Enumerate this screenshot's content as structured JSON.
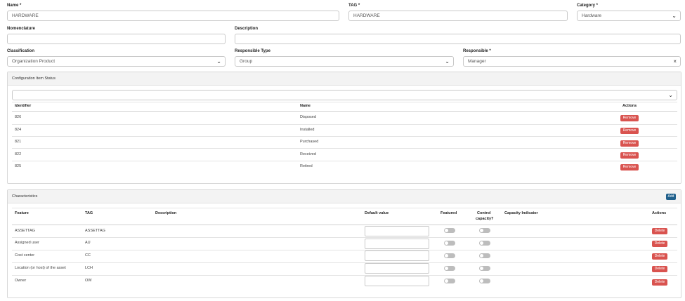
{
  "form": {
    "name": {
      "label": "Name *",
      "value": "HARDWARE"
    },
    "tag": {
      "label": "TAG *",
      "value": "HARDWARE"
    },
    "category": {
      "label": "Category *",
      "value": "Hardware"
    },
    "nomenclature": {
      "label": "Nomenclature",
      "value": ""
    },
    "description": {
      "label": "Description",
      "value": ""
    },
    "classification": {
      "label": "Classification",
      "value": "Organization Product"
    },
    "responsible_type": {
      "label": "Responsible Type",
      "value": "Group"
    },
    "responsible": {
      "label": "Responsible *",
      "value": "Manager"
    }
  },
  "status_panel": {
    "title": "Configuration Item Status",
    "columns": {
      "identifier": "Identifier",
      "name": "Name",
      "actions": "Actions"
    },
    "remove_label": "Remove",
    "rows": [
      {
        "id": "826",
        "name": "Disposed"
      },
      {
        "id": "824",
        "name": "Installed"
      },
      {
        "id": "821",
        "name": "Purchased"
      },
      {
        "id": "822",
        "name": "Received"
      },
      {
        "id": "825",
        "name": "Retired"
      }
    ]
  },
  "characteristics": {
    "title": "Characteristics",
    "add_label": "Add",
    "columns": {
      "feature": "Feature",
      "tag": "TAG",
      "description": "Description",
      "default_value": "Default value",
      "featured": "Featured",
      "control_capacity_1": "Control",
      "control_capacity_2": "capacity?",
      "capacity_indicator": "Capacity Indicator",
      "actions": "Actions"
    },
    "delete_label": "Delete",
    "rows": [
      {
        "feature": "ASSETTAG",
        "tag": "ASSETTAG"
      },
      {
        "feature": "Assigned user",
        "tag": "AU"
      },
      {
        "feature": "Cost center",
        "tag": "CC"
      },
      {
        "feature": "Location (or host) of the asset",
        "tag": "LCH"
      },
      {
        "feature": "Owner",
        "tag": "OW"
      }
    ]
  },
  "icons": {
    "dropdown": "chevron-down-icon",
    "clear": "close-icon"
  }
}
